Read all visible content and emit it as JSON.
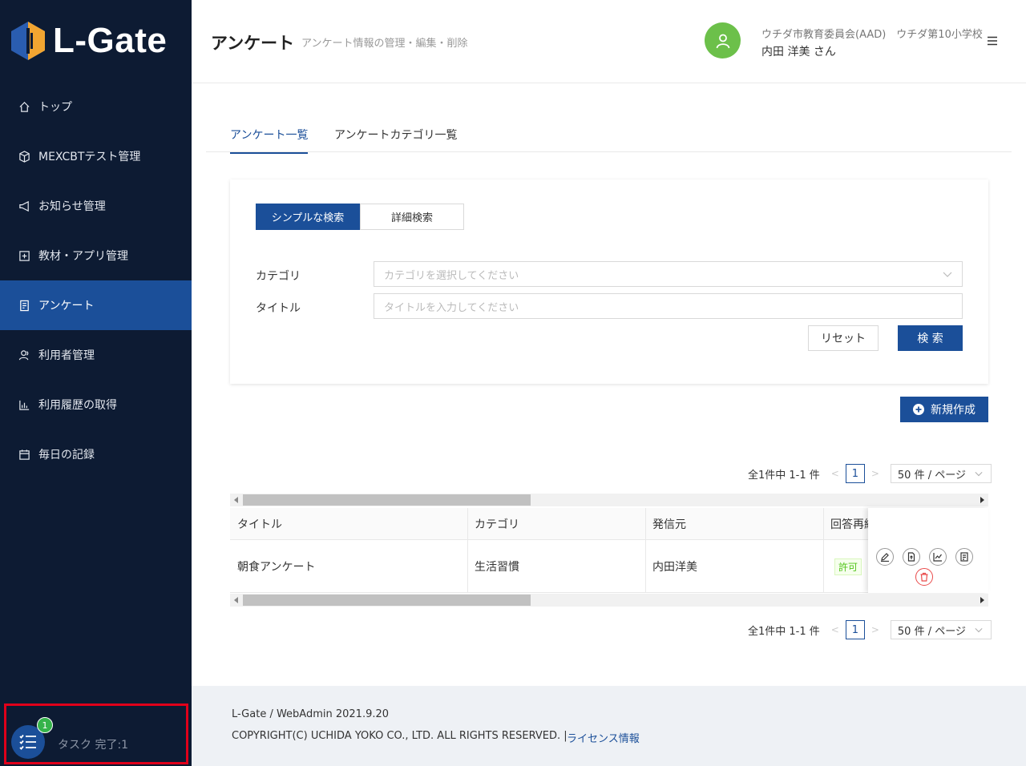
{
  "brand": {
    "name": "L-Gate"
  },
  "sidebar": {
    "items": [
      {
        "label": "トップ",
        "icon": "home-icon"
      },
      {
        "label": "MEXCBTテスト管理",
        "icon": "cube-icon"
      },
      {
        "label": "お知らせ管理",
        "icon": "megaphone-icon"
      },
      {
        "label": "教材・アプリ管理",
        "icon": "plus-square-icon"
      },
      {
        "label": "アンケート",
        "icon": "survey-icon",
        "active": true
      },
      {
        "label": "利用者管理",
        "icon": "users-icon"
      },
      {
        "label": "利用履歴の取得",
        "icon": "bar-chart-icon"
      },
      {
        "label": "毎日の記録",
        "icon": "calendar-icon"
      }
    ],
    "task": {
      "badge": "1",
      "label": "タスク 完了:1"
    }
  },
  "header": {
    "title": "アンケート",
    "subtitle": "アンケート情報の管理・編集・削除",
    "org": "ウチダ市教育委員会(AAD)　ウチダ第10小学校",
    "user": "内田 洋美 さん"
  },
  "tabs": [
    {
      "label": "アンケート一覧",
      "active": true
    },
    {
      "label": "アンケートカテゴリ一覧",
      "active": false
    }
  ],
  "search": {
    "mode_simple": "シンプルな検索",
    "mode_detail": "詳細検索",
    "category_label": "カテゴリ",
    "category_placeholder": "カテゴリを選択してください",
    "title_label": "タイトル",
    "title_placeholder": "タイトルを入力してください",
    "reset_label": "リセット",
    "search_label": "検 索"
  },
  "new_button": "新規作成",
  "pagination": {
    "summary": "全1件中 1-1 件",
    "current_page": "1",
    "page_size": "50 件 / ページ"
  },
  "table": {
    "columns": [
      "タイトル",
      "カテゴリ",
      "発信元",
      "回答再編"
    ],
    "rows": [
      {
        "title": "朝食アンケート",
        "category": "生活習慣",
        "sender": "内田洋美",
        "re_answer": "許可"
      }
    ]
  },
  "footer": {
    "version": "L-Gate / WebAdmin 2021.9.20",
    "copyright": "COPYRIGHT(C) UCHIDA YOKO CO., LTD. ALL RIGHTS RESERVED. |",
    "license_link": "ライセンス情報"
  },
  "colors": {
    "sidebar_bg": "#0d1b33",
    "primary": "#1b4f99",
    "avatar": "#6cc04a",
    "highlight_border": "#e0001a",
    "badge": "#35b34a",
    "permit": "#52c41a",
    "delete": "#e94b4b"
  }
}
